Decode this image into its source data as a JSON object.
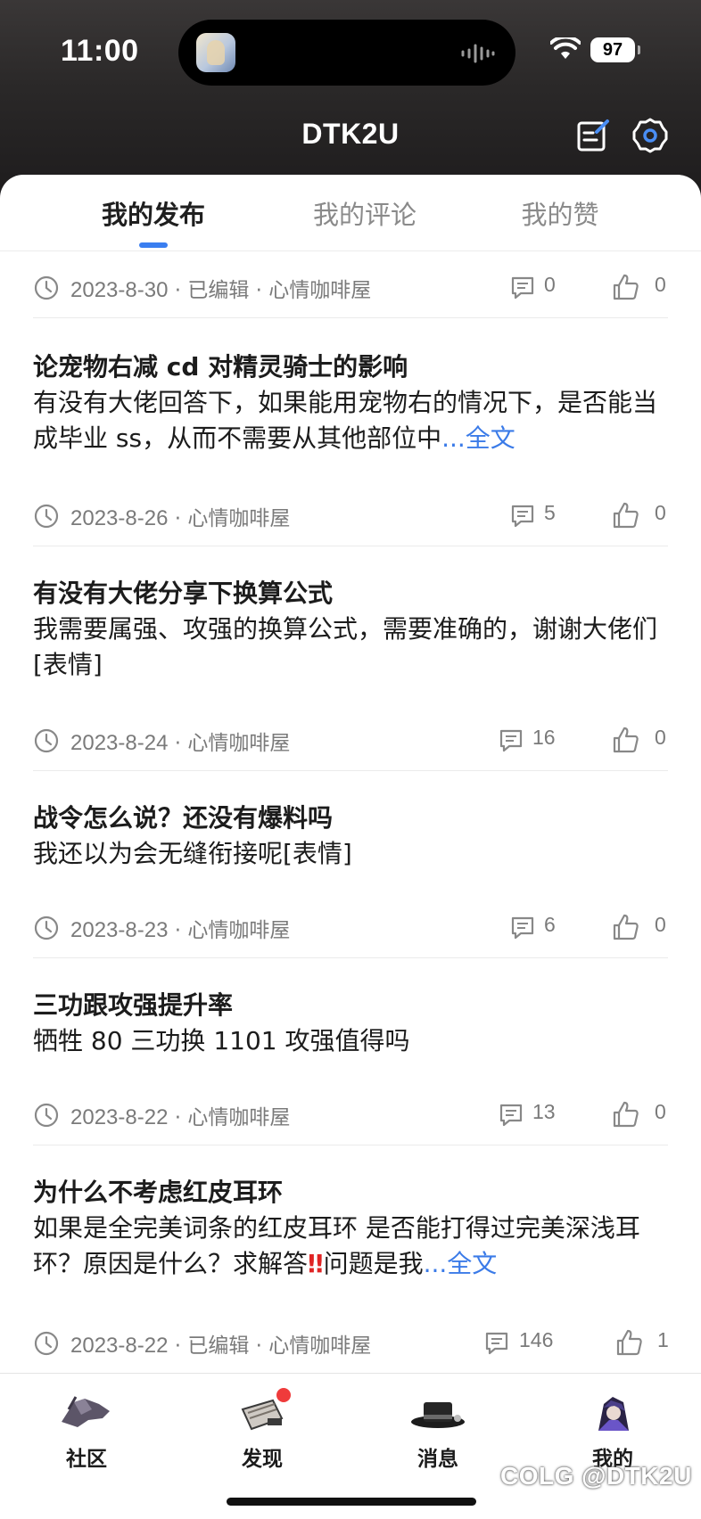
{
  "status_bar": {
    "time": "11:00",
    "battery": "97"
  },
  "header": {
    "title": "DTK2U"
  },
  "tabs": [
    {
      "label": "我的发布",
      "active": true
    },
    {
      "label": "我的评论",
      "active": false
    },
    {
      "label": "我的赞",
      "active": false
    }
  ],
  "posts": [
    {
      "title": "",
      "body": "",
      "more": "",
      "date": "2023-8-30",
      "edited": "已编辑",
      "forum": "心情咖啡屋",
      "comments": "0",
      "likes": "0"
    },
    {
      "title": "论宠物右减 cd 对精灵骑士的影响",
      "body": "有没有大佬回答下，如果能用宠物右的情况下，是否能当成毕业 ss，从而不需要从其他部位中",
      "more": "...全文",
      "date": "2023-8-26",
      "edited": "",
      "forum": "心情咖啡屋",
      "comments": "5",
      "likes": "0"
    },
    {
      "title": "有没有大佬分享下换算公式",
      "body": "我需要属强、攻强的换算公式，需要准确的，谢谢大佬们[表情]",
      "more": "",
      "date": "2023-8-24",
      "edited": "",
      "forum": "心情咖啡屋",
      "comments": "16",
      "likes": "0"
    },
    {
      "title": "战令怎么说？还没有爆料吗",
      "body": "我还以为会无缝衔接呢[表情]",
      "more": "",
      "date": "2023-8-23",
      "edited": "",
      "forum": "心情咖啡屋",
      "comments": "6",
      "likes": "0"
    },
    {
      "title": "三功跟攻强提升率",
      "body": "牺牲 80 三功换 1101 攻强值得吗",
      "more": "",
      "date": "2023-8-22",
      "edited": "",
      "forum": "心情咖啡屋",
      "comments": "13",
      "likes": "0"
    },
    {
      "title": "为什么不考虑红皮耳环",
      "body_before": " 如果是全完美词条的红皮耳环 是否能打得过完美深浅耳环？原因是什么？求解答",
      "exclaim": "‼",
      "body_after": "问题是我",
      "more": "...全文",
      "date": "2023-8-22",
      "edited": "已编辑",
      "forum": "心情咖啡屋",
      "comments": "146",
      "likes": "1"
    }
  ],
  "separator": "·",
  "bottom_tabs": [
    {
      "label": "社区",
      "active": false
    },
    {
      "label": "发现",
      "active": false,
      "badge": true
    },
    {
      "label": "消息",
      "active": false
    },
    {
      "label": "我的",
      "active": true
    }
  ],
  "watermark": "COLG @DTK2U",
  "colors": {
    "accent": "#3a7ef0",
    "active_tab_bar": "#f07a1c",
    "badge": "#ef3b3b"
  }
}
